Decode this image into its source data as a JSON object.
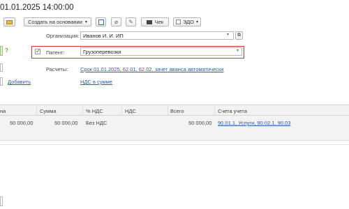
{
  "header": {
    "title": "01.01.2025 14:00:00"
  },
  "toolbar": {
    "create_based_on": "Создать на основании",
    "cheque": "Чек",
    "edo": "ЭДО"
  },
  "form": {
    "organization_label": "Организация:",
    "organization_value": "Иванов И. И. ИП",
    "patent_label": "Патент:",
    "patent_value": "Грузоперевозки",
    "calculations_label": "Расчеты:",
    "calculations_link": "Срок 01.01.2025, 62.01, 62.02, зачет аванса автоматически",
    "vat_link": "НДС в сумме",
    "help_mark": "?"
  },
  "add_button": "Добавить",
  "table": {
    "headers": [
      "на",
      "Сумма",
      "% НДС",
      "НДС",
      "Всего",
      "Счета учета"
    ],
    "row": {
      "price": "50 000,00",
      "sum": "50 000,00",
      "vat_rate": "Без НДС",
      "vat": "",
      "total": "50 000,00",
      "accounts": "90.01.1, Услуги, 90.02.1, 90.03"
    }
  },
  "colors": {
    "highlight": "#e03030",
    "link": "#2a5aa8",
    "check": "#2e8b2e"
  }
}
